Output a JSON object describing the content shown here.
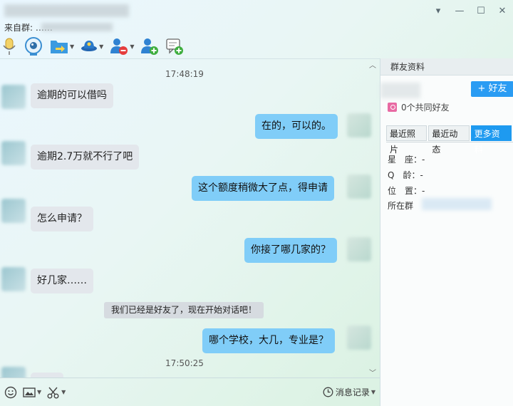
{
  "window": {
    "subtitle": "来自群:   ……",
    "controls": {
      "minimize_label": "▾",
      "restore_label": "—",
      "maximize_label": "☐",
      "close_label": "✕"
    }
  },
  "toolbar": {
    "items": [
      "microphone-icon",
      "video-camera-icon",
      "transfer-file-icon",
      "remote-assist-icon",
      "remove-member-icon",
      "add-member-icon",
      "new-message-icon"
    ]
  },
  "chat": {
    "timestamps": [
      "17:48:19",
      "17:50:25"
    ],
    "messages": [
      {
        "side": "in",
        "text": "逾期的可以借吗"
      },
      {
        "side": "out",
        "text": "在的，可以的。"
      },
      {
        "side": "in",
        "text": "逾期2.7万就不行了吧"
      },
      {
        "side": "out",
        "text": "这个额度稍微大了点，得申请"
      },
      {
        "side": "in",
        "text": "怎么申请？"
      },
      {
        "side": "out",
        "text": "你接了哪几家的？"
      },
      {
        "side": "in",
        "text": "好几家……"
      },
      {
        "side": "out",
        "text": "哪个学校，大几，专业是？"
      }
    ],
    "system_notice": "我们已经是好友了，现在开始对话吧！"
  },
  "input_bar": {
    "icons": [
      "emoji-icon",
      "image-icon",
      "scissors-icon"
    ],
    "history_label": "消息记录"
  },
  "panel": {
    "header": "群友资料",
    "add_friend_label": "+ 好友",
    "mutual_friends": "0个共同好友",
    "tabs": [
      "最近照片",
      "最近动态",
      "更多资料"
    ],
    "active_tab": "更多资料",
    "info": {
      "constellation_label": "星　座：-",
      "q_age_label": "Q　龄：-",
      "location_label": "位　置：-",
      "group_label": "所在群"
    }
  },
  "colors": {
    "outgoing_bubble": "#80cdf8",
    "incoming_bubble": "#e3e7ec",
    "accent_blue": "#2a9cf3",
    "active_tab": "#1e9af0"
  }
}
